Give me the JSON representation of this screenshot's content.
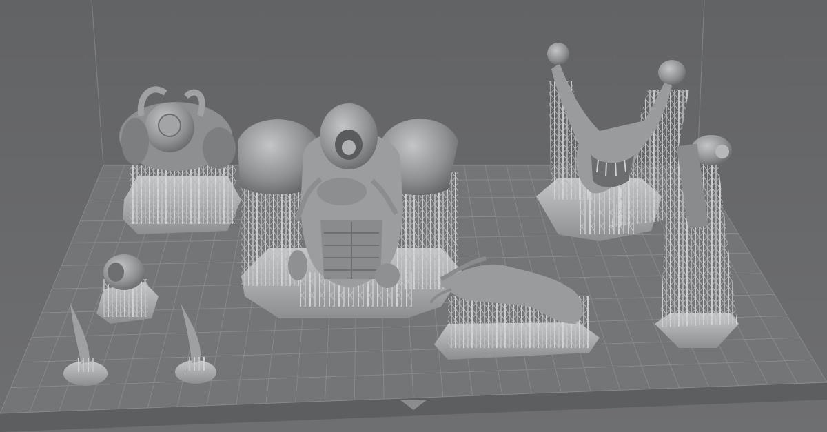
{
  "viewport": {
    "background_color": "#6b6c6e",
    "build_plate_color": "#747577",
    "grid_line_color": "#8a8b8d",
    "model_color": "#a9aaac",
    "support_color": "#d2d3d4"
  },
  "objects": [
    {
      "name": "helmet-pack",
      "type": "supported-part"
    },
    {
      "name": "armored-torso",
      "type": "supported-part"
    },
    {
      "name": "demon-head",
      "type": "supported-part"
    },
    {
      "name": "cannon-barrel",
      "type": "supported-part"
    },
    {
      "name": "small-dome",
      "type": "supported-part"
    },
    {
      "name": "horn-left",
      "type": "supported-part"
    },
    {
      "name": "horn-right",
      "type": "supported-part"
    },
    {
      "name": "clawed-hand",
      "type": "supported-part"
    }
  ]
}
